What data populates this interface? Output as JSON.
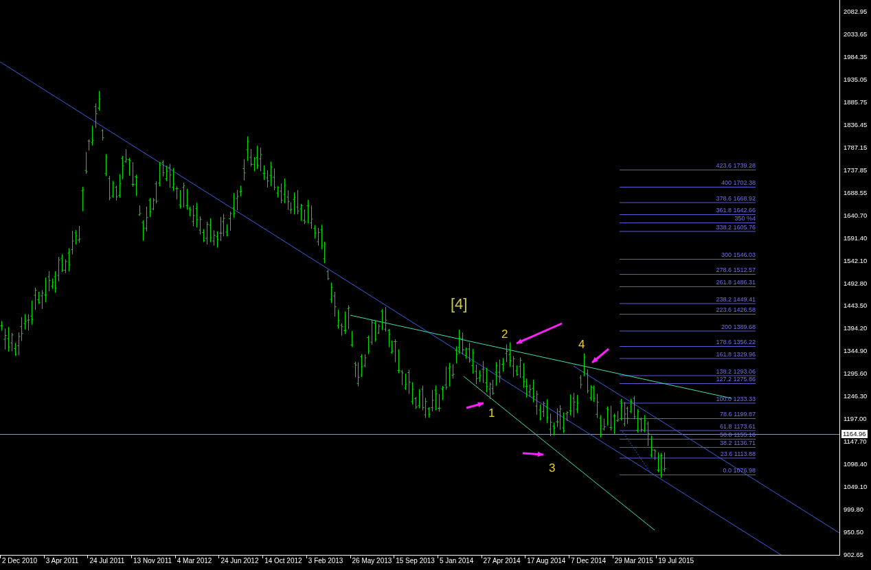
{
  "price_axis": {
    "labels": [
      "2082.95",
      "2033.65",
      "1984.35",
      "1935.05",
      "1885.75",
      "1836.45",
      "1787.15",
      "1737.85",
      "1688.55",
      "1640.70",
      "1591.40",
      "1542.10",
      "1492.80",
      "1443.50",
      "1394.20",
      "1344.90",
      "1295.60",
      "1246.30",
      "1197.00",
      "1147.70",
      "1098.40",
      "1049.10",
      "999.80",
      "950.50",
      "902.65"
    ],
    "current_price": "1164.96"
  },
  "time_axis": {
    "labels": [
      "2 Dec 2010",
      "3 Apr 2011",
      "24 Jul 2011",
      "13 Nov 2011",
      "4 Mar 2012",
      "24 Jun 2012",
      "14 Oct 2012",
      "3 Feb 2013",
      "26 May 2013",
      "15 Sep 2013",
      "5 Jan 2014",
      "27 Apr 2014",
      "17 Aug 2014",
      "7 Dec 2014",
      "29 Mar 2015",
      "19 Jul 2015"
    ]
  },
  "fibonacci": {
    "levels": [
      "423.6 1739.28",
      "400 1702.38",
      "378.6 1668.92",
      "361.8 1642.66",
      "350 %4",
      "338.2 1605.76",
      "300 1546.03",
      "278.6 1512.57",
      "261.8 1486.31",
      "238.2 1449.41",
      "223.6 1426.58",
      "200 1389.68",
      "178.6 1356.22",
      "161.8 1329.96",
      "138.2 1293.06",
      "127.2 1275.86",
      "100.0 1233.33",
      "78.6 1199.87",
      "61.8 1173.61",
      "50.0 1155.16",
      "38.2 1136.71",
      "23.6 1113.88",
      "0.0 1076.98"
    ]
  },
  "wave_labels": [
    {
      "text": "[4]",
      "kind": "intermediate"
    },
    {
      "text": "2",
      "kind": "minor"
    },
    {
      "text": "1",
      "kind": "minor"
    },
    {
      "text": "3",
      "kind": "minor"
    },
    {
      "text": "4",
      "kind": "minor"
    }
  ]
}
